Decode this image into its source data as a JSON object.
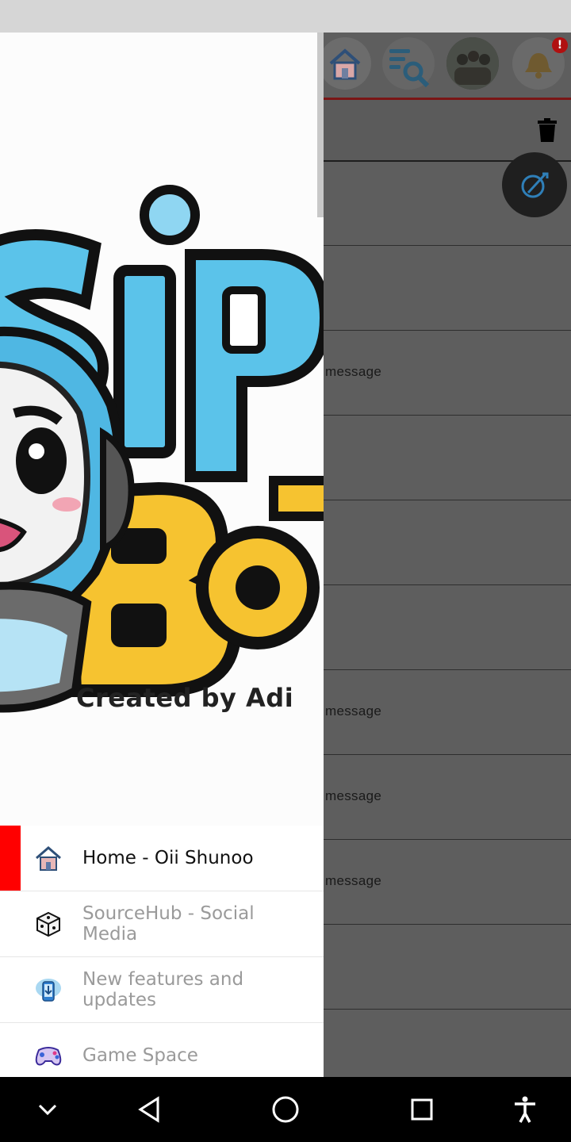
{
  "background_screen": {
    "toolbar_icons": [
      "home-icon",
      "search-list-icon",
      "group-avatar",
      "bell-icon"
    ],
    "notification_badge": "!",
    "row_message_label": "message",
    "row_labels": [
      "",
      "",
      "message",
      "",
      "",
      "",
      "message",
      "message",
      "message",
      "",
      ""
    ]
  },
  "drawer": {
    "logo": {
      "wordmark_top": "SiPo",
      "wordmark_bottom": "BoT",
      "credit": "Created by Adi"
    },
    "menu": [
      {
        "label": "Home - Oii Shunoo",
        "icon": "house-icon",
        "active": true
      },
      {
        "label": "SourceHub - Social Media",
        "icon": "dice-icon",
        "active": false
      },
      {
        "label": "New features and updates",
        "icon": "phone-download-icon",
        "active": false
      },
      {
        "label": "Game Space",
        "icon": "gamepad-icon",
        "active": false
      }
    ]
  },
  "nav_bar": {
    "buttons": [
      "chevron-down-icon",
      "back-icon",
      "home-circle-icon",
      "recents-icon",
      "accessibility-icon"
    ]
  },
  "colors": {
    "active_indicator": "#ff0000",
    "scrim": "#5e5e5e",
    "toolbar_underline": "#7a1616",
    "logo_blue": "#5bc3ea",
    "logo_yellow": "#f6c330"
  }
}
